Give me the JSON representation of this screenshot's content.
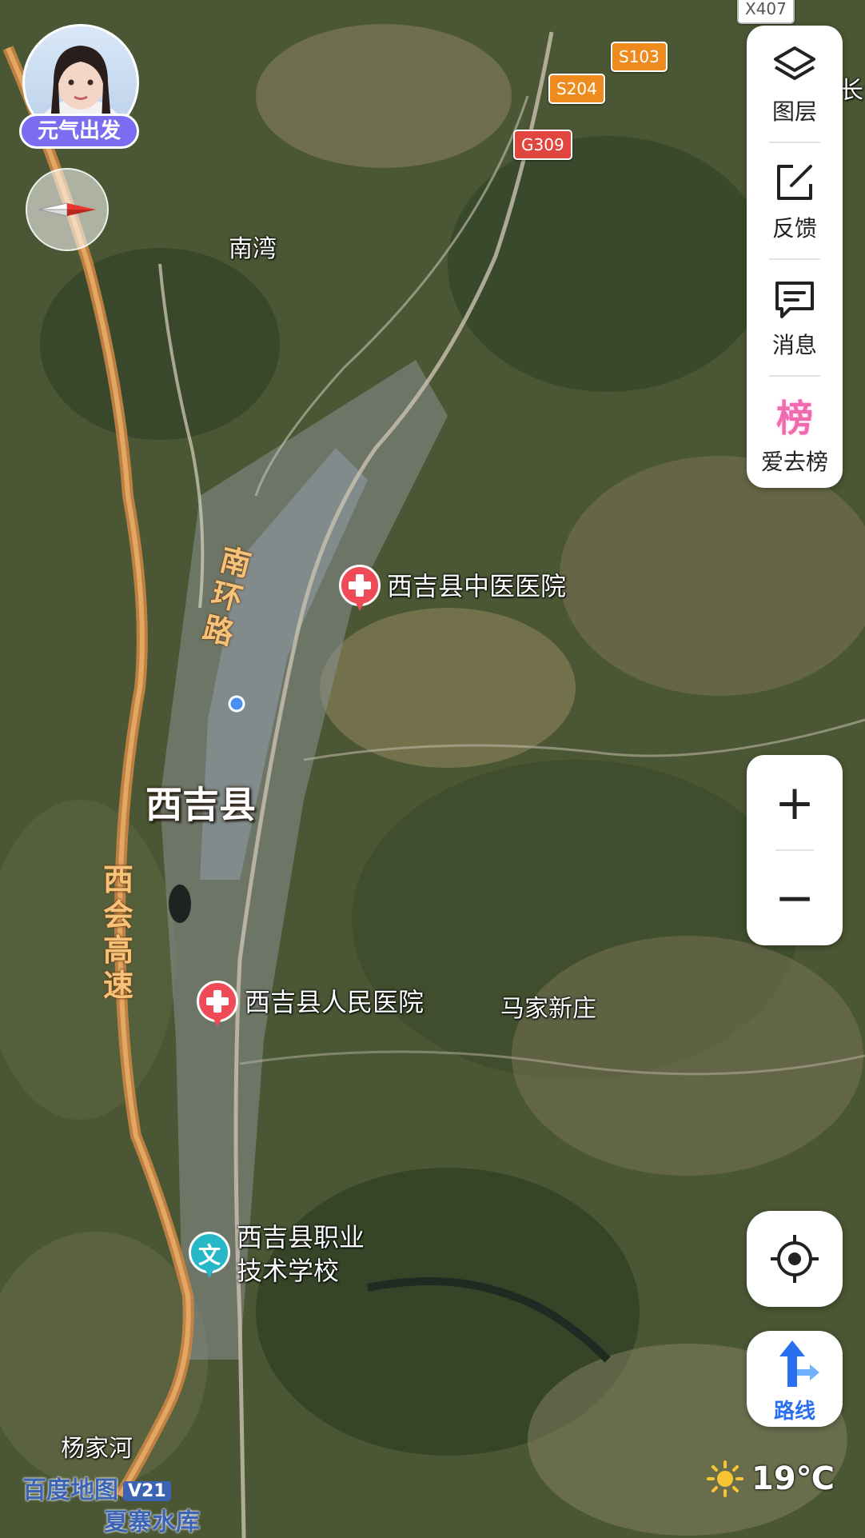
{
  "map": {
    "place_labels": [
      {
        "id": "nanwan",
        "text": "南湾"
      },
      {
        "id": "majiaxinzhuang",
        "text": "马家新庄"
      },
      {
        "id": "yangjiahe",
        "text": "杨家河"
      },
      {
        "id": "xiazhai-reservoir",
        "text": "夏寨水库"
      },
      {
        "id": "edge",
        "text": "长:"
      }
    ],
    "city_label": "西吉县",
    "road_labels": {
      "ring": "南环路",
      "expressway": "西会高速"
    },
    "shields": {
      "x407": "X407",
      "s103": "S103",
      "s204": "S204",
      "g309": "G309"
    },
    "pois": {
      "tcm_hospital": {
        "name": "西吉县中医医院",
        "icon": "hospital-icon"
      },
      "peoples_hospital": {
        "name": "西吉县人民医院",
        "icon": "hospital-icon"
      },
      "vocational_school": {
        "name_line1": "西吉县职业",
        "name_line2": "技术学校",
        "icon": "school-icon",
        "glyph": "文"
      }
    }
  },
  "toolbar": {
    "layers": "图层",
    "feedback": "反馈",
    "messages": "消息",
    "ranking": "爱去榜",
    "ranking_glyph": "榜"
  },
  "zoom": {
    "in": "+",
    "out": "−"
  },
  "route": {
    "label": "路线"
  },
  "avatar": {
    "tag": "元气出发"
  },
  "brand": {
    "name": "百度地图",
    "version": "V21"
  },
  "weather": {
    "temp": "19℃",
    "icon": "sun-icon"
  },
  "colors": {
    "hospital": "#ee4b57",
    "school": "#27b8c7",
    "route": "#2a6ff0",
    "brand": "#3d63b4",
    "expressway": "#d69553"
  }
}
